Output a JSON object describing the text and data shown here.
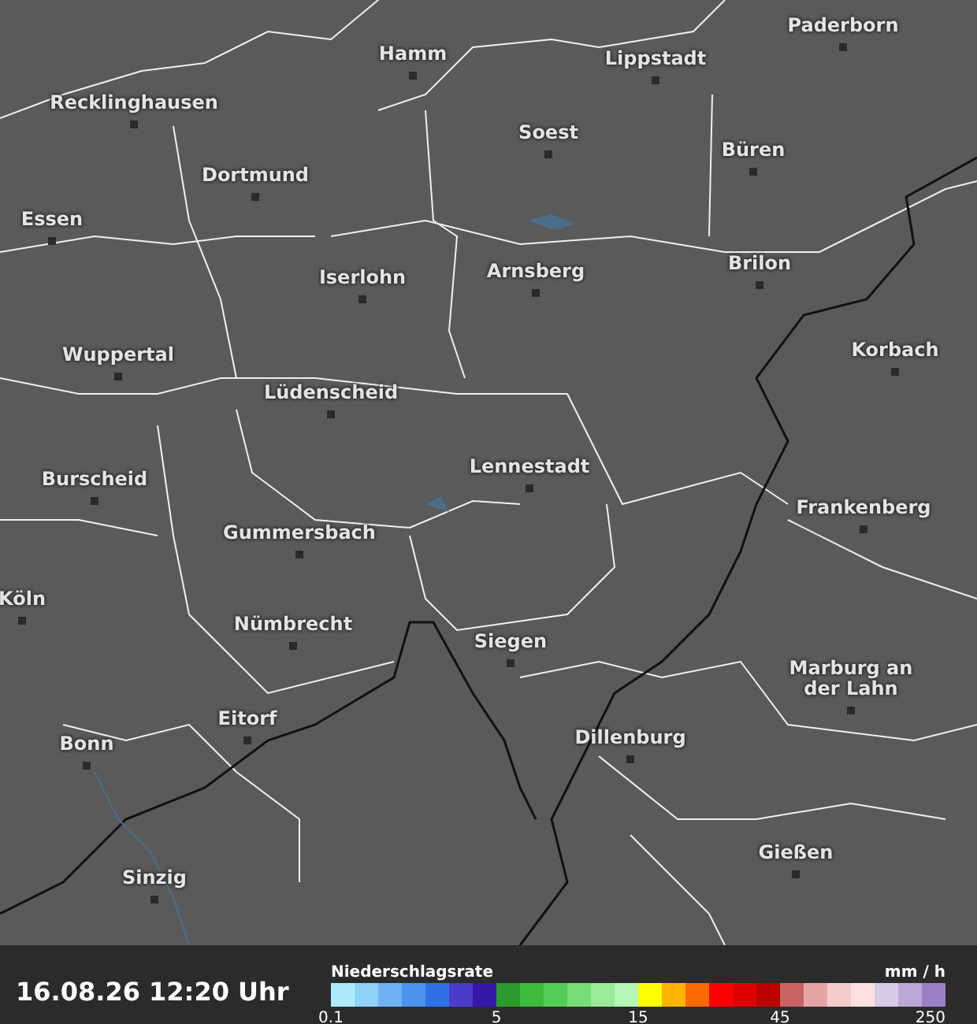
{
  "map": {
    "cities": [
      {
        "name": "Paderborn"
      },
      {
        "name": "Hamm"
      },
      {
        "name": "Lippstadt"
      },
      {
        "name": "Recklinghausen"
      },
      {
        "name": "Soest"
      },
      {
        "name": "Büren"
      },
      {
        "name": "Dortmund"
      },
      {
        "name": "Essen"
      },
      {
        "name": "Iserlohn"
      },
      {
        "name": "Arnsberg"
      },
      {
        "name": "Brilon"
      },
      {
        "name": "Wuppertal"
      },
      {
        "name": "Korbach"
      },
      {
        "name": "Lüdenscheid"
      },
      {
        "name": "Burscheid"
      },
      {
        "name": "Lennestadt"
      },
      {
        "name": "Frankenberg"
      },
      {
        "name": "Gummersbach"
      },
      {
        "name": "Köln"
      },
      {
        "name": "Nümbrecht"
      },
      {
        "name": "Siegen"
      },
      {
        "name": "Marburg an der Lahn"
      },
      {
        "name": "Bonn"
      },
      {
        "name": "Eitorf"
      },
      {
        "name": "Dillenburg"
      },
      {
        "name": "Gießen"
      },
      {
        "name": "Sinzig"
      }
    ]
  },
  "footer": {
    "timestamp": "16.08.26 12:20 Uhr",
    "legend": {
      "title": "Niederschlagsrate",
      "unit": "mm / h",
      "swatches": [
        {
          "color": "#aeeafb",
          "tick": "0.1"
        },
        {
          "color": "#8fd2f7"
        },
        {
          "color": "#6fb2f3"
        },
        {
          "color": "#4c92ef"
        },
        {
          "color": "#2f70e6"
        },
        {
          "color": "#4a3cc8"
        },
        {
          "color": "#3418a8"
        },
        {
          "color": "#2a9a2a",
          "tick": "5"
        },
        {
          "color": "#3dbb3d"
        },
        {
          "color": "#55cc55"
        },
        {
          "color": "#77dd77"
        },
        {
          "color": "#99ea99"
        },
        {
          "color": "#b5f7b5"
        },
        {
          "color": "#ffff00",
          "tick": "15"
        },
        {
          "color": "#ffb400"
        },
        {
          "color": "#ff6a00"
        },
        {
          "color": "#ff0000"
        },
        {
          "color": "#dd0000"
        },
        {
          "color": "#bb0000"
        },
        {
          "color": "#c86464",
          "tick": "45"
        },
        {
          "color": "#e6a5a5"
        },
        {
          "color": "#f4cccc"
        },
        {
          "color": "#fde0e0"
        },
        {
          "color": "#d8cbe8"
        },
        {
          "color": "#bca8d8"
        },
        {
          "color": "#9c7fc4",
          "tick_end": "250"
        }
      ]
    }
  }
}
